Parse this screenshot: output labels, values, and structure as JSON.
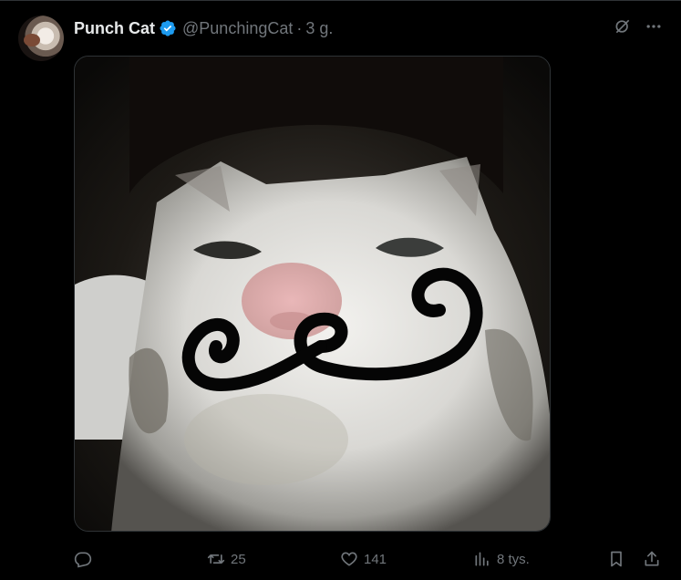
{
  "tweet": {
    "author_name": "Punch Cat",
    "verified_icon": "verified-badge-icon",
    "handle": "@PunchingCat",
    "separator": "·",
    "time": "3 g.",
    "top_icons": [
      "grok-icon",
      "more-icon"
    ],
    "more_label": "···"
  },
  "actions": {
    "reply": {
      "icon": "reply-icon",
      "count": ""
    },
    "retweet": {
      "icon": "retweet-icon",
      "count": "25"
    },
    "like": {
      "icon": "heart-icon",
      "count": "141"
    },
    "views": {
      "icon": "views-icon",
      "count": "8 tys."
    },
    "bookmark": {
      "icon": "bookmark-icon"
    },
    "share": {
      "icon": "share-icon"
    }
  },
  "colors": {
    "background": "#000000",
    "text": "#e7e9ea",
    "muted": "#71767b",
    "verified": "#1d9bf0",
    "border": "#2f3336"
  }
}
